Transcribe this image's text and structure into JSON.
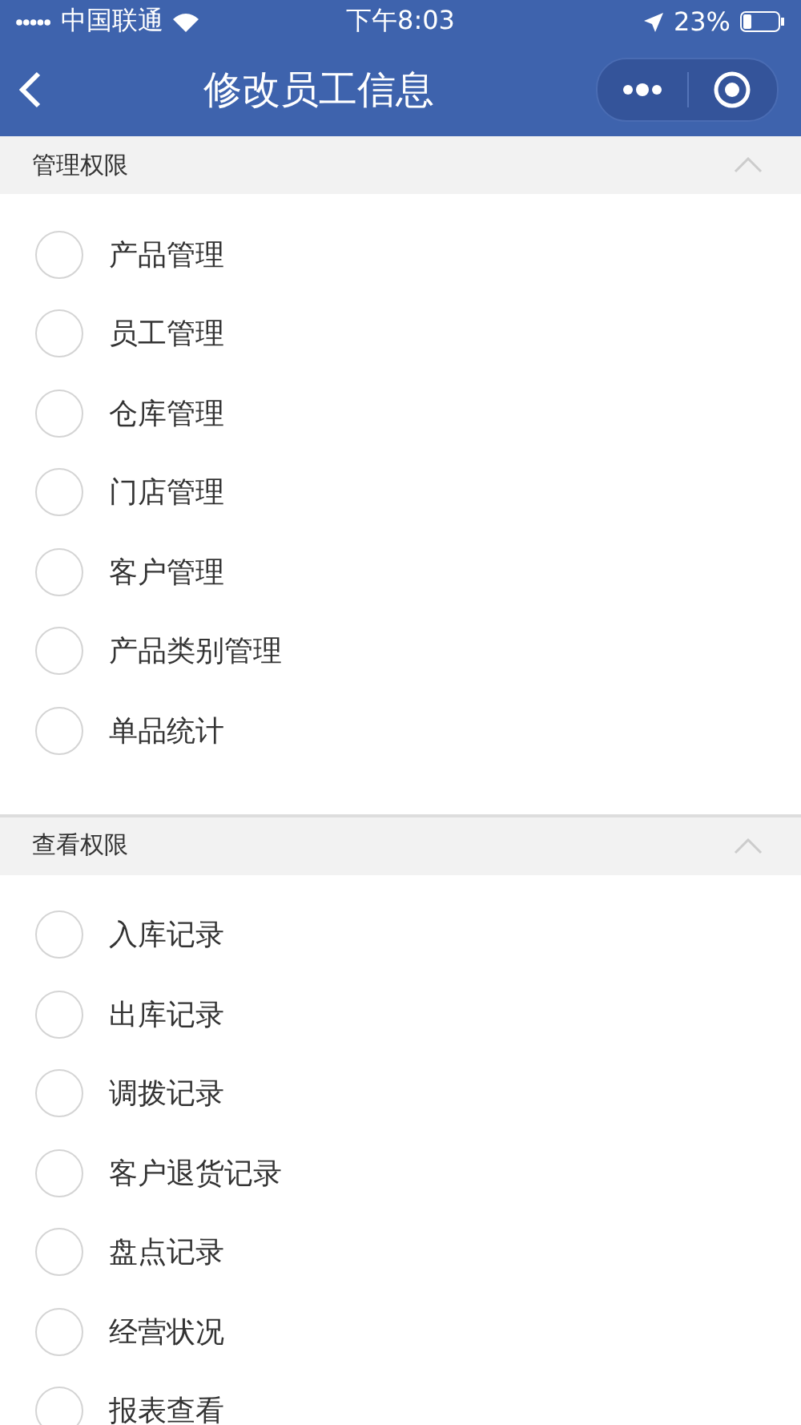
{
  "status_bar": {
    "carrier": "中国联通",
    "time": "下午8:03",
    "battery": "23%"
  },
  "nav_bar": {
    "title": "修改员工信息"
  },
  "sections": [
    {
      "title": "管理权限",
      "expanded": true,
      "items": [
        {
          "label": "产品管理",
          "checked": false
        },
        {
          "label": "员工管理",
          "checked": false
        },
        {
          "label": "仓库管理",
          "checked": false
        },
        {
          "label": "门店管理",
          "checked": false
        },
        {
          "label": "客户管理",
          "checked": false
        },
        {
          "label": "产品类别管理",
          "checked": false
        },
        {
          "label": "单品统计",
          "checked": false
        }
      ]
    },
    {
      "title": "查看权限",
      "expanded": true,
      "items": [
        {
          "label": "入库记录",
          "checked": false
        },
        {
          "label": "出库记录",
          "checked": false
        },
        {
          "label": "调拨记录",
          "checked": false
        },
        {
          "label": "客户退货记录",
          "checked": false
        },
        {
          "label": "盘点记录",
          "checked": false
        },
        {
          "label": "经营状况",
          "checked": false
        },
        {
          "label": "报表查看",
          "checked": false
        }
      ]
    }
  ]
}
